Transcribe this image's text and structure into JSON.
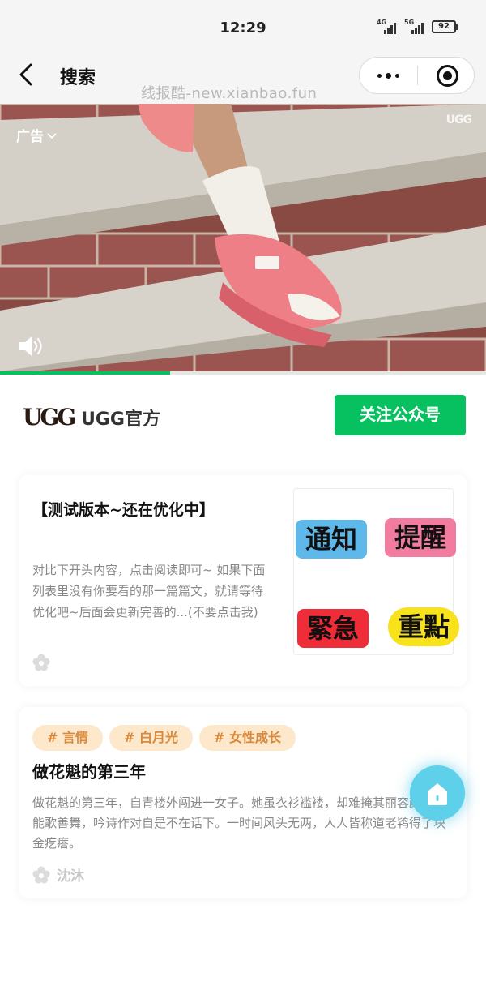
{
  "status_bar": {
    "time": "12:29",
    "signal_1_label": "4G",
    "signal_2_label": "5G",
    "battery": "92"
  },
  "nav": {
    "title": "搜索",
    "watermark": "线报酷-new.xianbao.fun"
  },
  "ad": {
    "label": "广告",
    "brand_mark": "UGG",
    "progress_percent": 35
  },
  "account": {
    "logo_text": "UGG",
    "name": "UGG官方",
    "follow_label": "关注公众号"
  },
  "articles": [
    {
      "title": "【测试版本~还在优化中】",
      "summary": "对比下开头内容，点击阅读即可~ 如果下面列表里没有你要看的那一篇篇文，就请等待优化吧~后面会更新完善的...(不要点击我)",
      "thumbnail_words": [
        "通知",
        "提醒",
        "緊急",
        "重點"
      ]
    },
    {
      "tags": [
        "# 言情",
        "# 白月光",
        "# 女性成长"
      ],
      "title": "做花魁的第三年",
      "summary": "做花魁的第三年，自青楼外闯进一女子。她虽衣衫褴褛，却难掩其丽容颜。且能歌善舞，吟诗作对自是不在话下。一时间风头无两，人人皆称道老鸨得了块金疙瘩。",
      "author": "沈沐"
    }
  ],
  "colors": {
    "accent": "#07c160",
    "tag_bg": "#fde8cc",
    "tag_text": "#d8893a",
    "float_button": "#5fd0ea"
  },
  "icons": [
    "back-arrow-icon",
    "more-dots-icon",
    "close-target-icon",
    "chevron-down-icon",
    "speaker-icon",
    "flower-icon",
    "home-icon"
  ]
}
